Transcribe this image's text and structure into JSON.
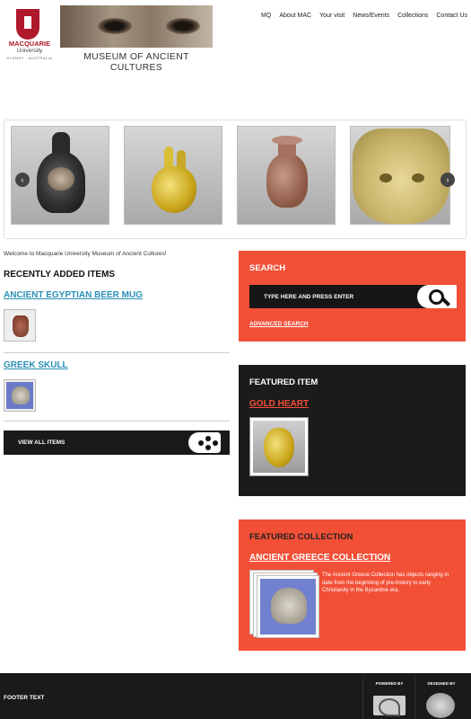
{
  "header": {
    "university": {
      "name": "MACQUARIE",
      "sub": "University",
      "tag": "SYDNEY · AUSTRALIA"
    },
    "museum_title": "MUSEUM OF ANCIENT CULTURES",
    "nav": [
      "MQ",
      "About MAC",
      "Your visit",
      "News/Events",
      "Collections",
      "Contact Us"
    ]
  },
  "carousel": {
    "prev": "‹",
    "next": "›",
    "slides": [
      "vase",
      "gold-heart",
      "terracotta-jar",
      "bes-mask"
    ]
  },
  "intro": {
    "welcome": "Welcome to Macquarie University Museum of Ancient Cultures!",
    "recent_heading": "RECENTLY ADDED ITEMS",
    "items": [
      {
        "title": "ANCIENT EGYPTIAN BEER MUG"
      },
      {
        "title": "GREEK SKULL"
      }
    ],
    "view_all": "VIEW ALL ITEMS"
  },
  "search": {
    "title": "SEARCH",
    "placeholder": "TYPE HERE AND PRESS ENTER",
    "advanced": "ADVANCED SEARCH"
  },
  "featured_item": {
    "title": "FEATURED ITEM",
    "name": "GOLD HEART"
  },
  "featured_collection": {
    "title": "FEATURED COLLECTION",
    "name": "ANCIENT GREECE COLLECTION",
    "description": "The Ancient Greece Collection has objects ranging in date from the beginning of pre-history to early Christianity in the Byzantine era."
  },
  "footer": {
    "text": "FOOTER TEXT",
    "powered_by": "POWERED BY",
    "designed_by": "DESIGNED BY"
  },
  "colors": {
    "accent": "#f24f37",
    "dark": "#1c1b1b",
    "link": "#2a8fb7"
  }
}
